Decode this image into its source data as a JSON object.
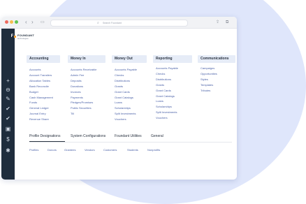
{
  "browser": {
    "url_placeholder": "Search Foundant",
    "back_icon": "chevron-left-icon",
    "forward_icon": "chevron-right-icon",
    "sidebar_toggle_icon": "sidebar-icon",
    "share_icon": "share-icon",
    "tabs_icon": "tabs-icon",
    "traffic_colors": [
      "#ee6a5f",
      "#f5be4f",
      "#62c554"
    ]
  },
  "logo": {
    "name": "FOUNDANT",
    "sub": "technologies"
  },
  "sidebar": {
    "icons": [
      "plus-icon",
      "minus-icon",
      "pencil-icon",
      "check-icon",
      "check-icon",
      "calendar-icon",
      "dollar-icon",
      "gear-icon"
    ],
    "glyphs": [
      "+",
      "⊖",
      "✎",
      "✔",
      "✔",
      "▣",
      "$",
      "✱"
    ]
  },
  "columns": [
    {
      "title": "Accounting",
      "items": [
        "Accounts",
        "Account Transfers",
        "Allocation Tables",
        "Bank Reconcile",
        "Budget",
        "Cash Management",
        "Funds",
        "General Ledger",
        "Journal Entry",
        "Revenue Share"
      ]
    },
    {
      "title": "Money In",
      "items": [
        "Accounts Receivable",
        "Admin Fee",
        "Deposits",
        "Donations",
        "Invoices",
        "Payments",
        "Pledges/Promises",
        "Public Securities",
        "Till"
      ]
    },
    {
      "title": "Money Out",
      "items": [
        "Accounts Payable",
        "Checks",
        "Distributions",
        "Grants",
        "Grant Cards",
        "Grant Catalogs",
        "Loans",
        "Scholarships",
        "Split Investments",
        "Vouchers"
      ]
    },
    {
      "title": "Reporting",
      "items": [
        "Accounts Payable",
        "Checks",
        "Distributions",
        "Grants",
        "Grant Cards",
        "Grant Catalogs",
        "Loans",
        "Scholarships",
        "Split Investments",
        "Vouchers"
      ]
    },
    {
      "title": "Communications",
      "items": [
        "Campaigns",
        "Opportunities",
        "Styles",
        "Templates",
        "Tributes"
      ]
    }
  ],
  "tabs": [
    "Profile Designations",
    "System Configurations",
    "Foundant Utilities",
    "General"
  ],
  "subtabs": [
    "Profiles",
    "Donors",
    "Grantees",
    "Vendors",
    "Customers",
    "Students",
    "Nonprofits"
  ]
}
